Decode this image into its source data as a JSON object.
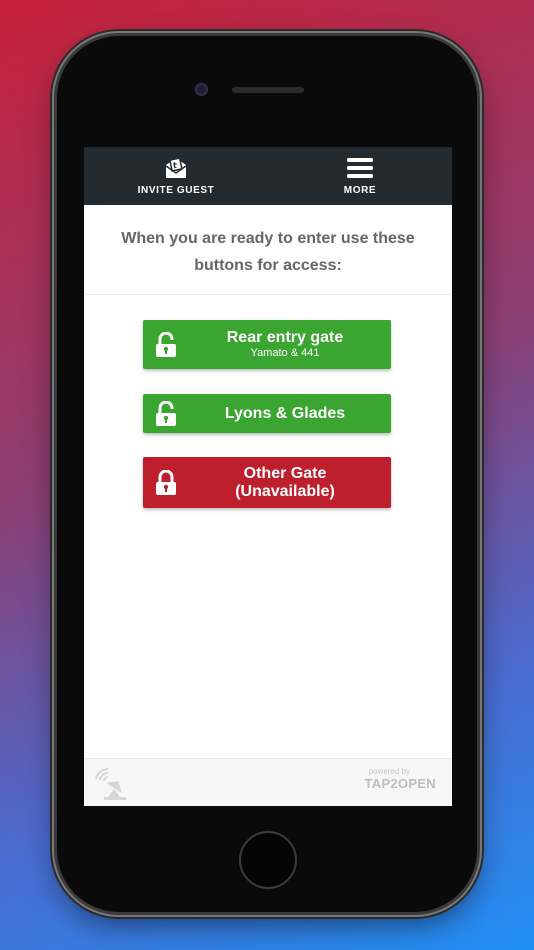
{
  "nav": {
    "invite_label": "INVITE GUEST",
    "more_label": "MORE"
  },
  "intro": {
    "line1": "When you are ready to enter use these",
    "line2": "buttons for access:"
  },
  "gates": [
    {
      "title": "Rear entry gate",
      "subtitle": "Yamato & 441",
      "status": "available",
      "color": "#3aa631",
      "icon": "unlock-icon"
    },
    {
      "title": "Lyons & Glades",
      "subtitle": "",
      "status": "available",
      "color": "#3aa631",
      "icon": "unlock-icon"
    },
    {
      "title": "Other Gate",
      "subtitle": "(Unavailable)",
      "status": "unavailable",
      "color": "#be1f2c",
      "icon": "lock-icon"
    }
  ],
  "footer": {
    "powered_by": "powered by",
    "brand": "TAP2OPEN"
  }
}
